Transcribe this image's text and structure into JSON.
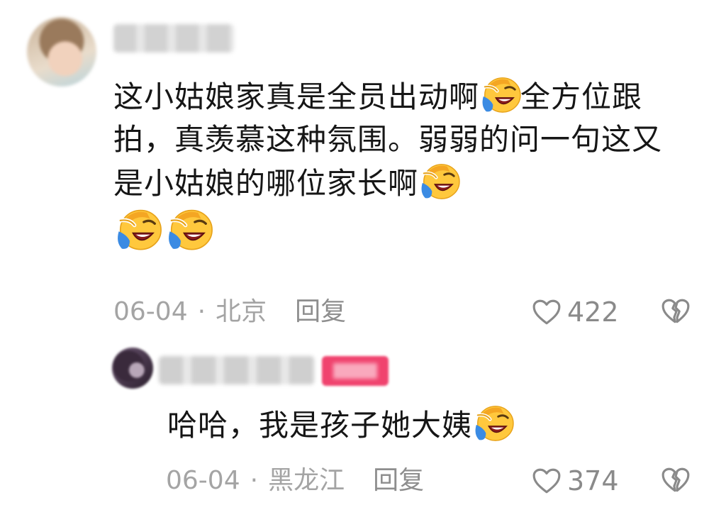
{
  "comment": {
    "text_line1": "这小姑娘家真是全员出动啊",
    "text_line1b": "全方位跟拍，真羡慕这种氛围。弱弱的问一句这又是小姑娘的哪位家长啊",
    "date": "06-04",
    "location": "北京",
    "reply_label": "回复",
    "likes": "422",
    "emoji_icon": "laughing-crying-emoji"
  },
  "reply": {
    "text": "哈哈，我是孩子她大姨",
    "date": "06-04",
    "location": "黑龙江",
    "reply_label": "回复",
    "likes": "374"
  },
  "separator": "·",
  "colors": {
    "text": "#161616",
    "meta": "#a4a4a4",
    "badge": "#f0436e",
    "emoji_face": "#ffc83d",
    "emoji_tear": "#3b8be3"
  }
}
